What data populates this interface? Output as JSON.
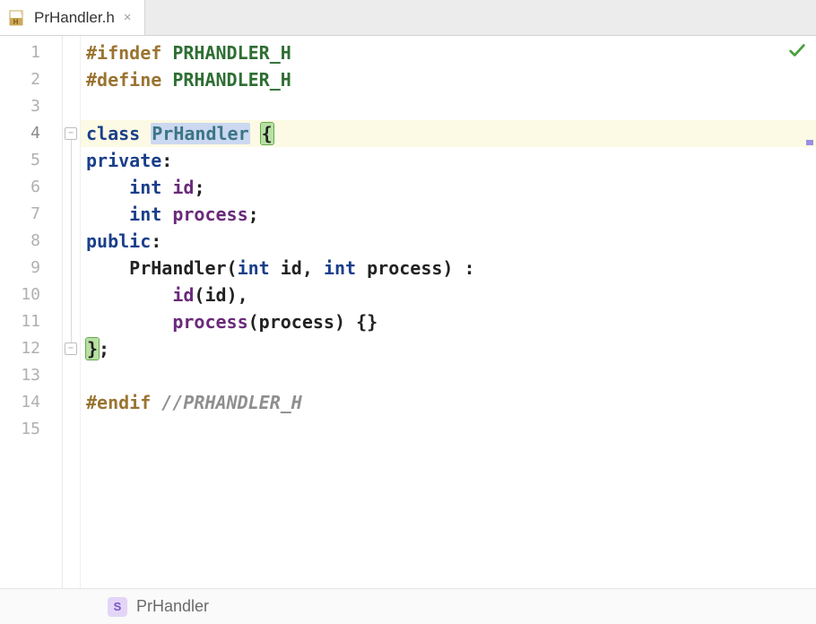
{
  "tab": {
    "filename": "PrHandler.h",
    "close_glyph": "×"
  },
  "gutter": {
    "lines": [
      "1",
      "2",
      "3",
      "4",
      "5",
      "6",
      "7",
      "8",
      "9",
      "10",
      "11",
      "12",
      "13",
      "14",
      "15"
    ]
  },
  "code": {
    "l1": {
      "pp": "#ifndef ",
      "macro": "PRHANDLER_H"
    },
    "l2": {
      "pp": "#define ",
      "macro": "PRHANDLER_H"
    },
    "l3": {
      "txt": ""
    },
    "l4": {
      "kw": "class ",
      "name": "PrHandler",
      "sp": " ",
      "brace": "{"
    },
    "l5": {
      "kw": "private",
      "colon": ":"
    },
    "l6": {
      "indent": "    ",
      "kw": "int",
      "sp": " ",
      "id": "id",
      "semi": ";"
    },
    "l7": {
      "indent": "    ",
      "kw": "int",
      "sp": " ",
      "id": "process",
      "semi": ";"
    },
    "l8": {
      "kw": "public",
      "colon": ":"
    },
    "l9": {
      "indent": "    ",
      "ctor": "PrHandler",
      "open": "(",
      "kw1": "int",
      "sp1": " ",
      "id1": "id",
      "comma": ", ",
      "kw2": "int",
      "sp2": " ",
      "id2": "process",
      "close": ")",
      "sp3": " ",
      "colon": ":"
    },
    "l10": {
      "indent": "        ",
      "id": "id",
      "open": "(",
      "arg": "id",
      "close": ")",
      "comma": ","
    },
    "l11": {
      "indent": "        ",
      "id": "process",
      "open": "(",
      "arg": "process",
      "close": ")",
      "sp": " ",
      "braces": "{}"
    },
    "l12": {
      "brace": "}",
      "semi": ";"
    },
    "l13": {
      "txt": ""
    },
    "l14": {
      "pp": "#endif ",
      "comment": "//PRHANDLER_H"
    },
    "l15": {
      "txt": ""
    }
  },
  "breadcrumb": {
    "icon_letter": "S",
    "label": "PrHandler"
  },
  "icons": {
    "header_file": "H",
    "fold_minus": "−",
    "check": "✓"
  }
}
